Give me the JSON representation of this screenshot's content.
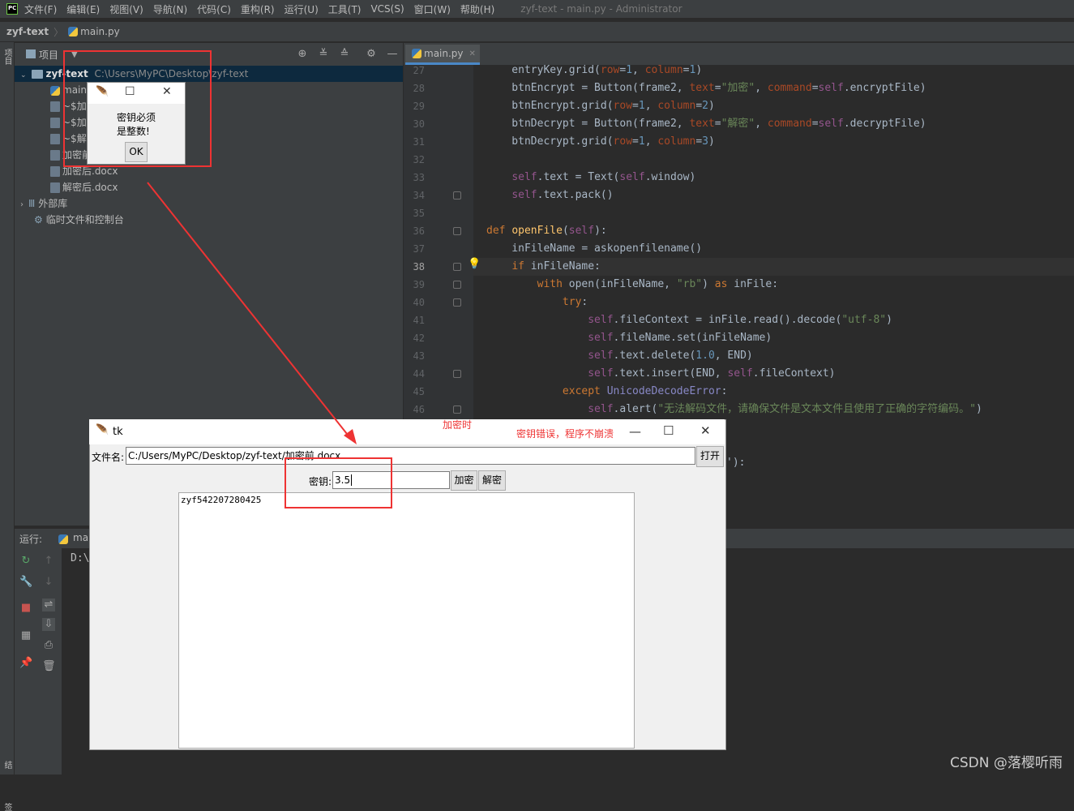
{
  "menu": {
    "logo": "PC",
    "items": [
      "文件(F)",
      "编辑(E)",
      "视图(V)",
      "导航(N)",
      "代码(C)",
      "重构(R)",
      "运行(U)",
      "工具(T)",
      "VCS(S)",
      "窗口(W)",
      "帮助(H)"
    ],
    "window_title": "zyf-text - main.py - Administrator"
  },
  "breadcrumb": {
    "project": "zyf-text",
    "file": "main.py"
  },
  "side_stripe": {
    "top": "项目",
    "bottom": "结构",
    "bottom2": "签"
  },
  "project_panel": {
    "header": "项目",
    "root_name": "zyf-text",
    "root_path": "C:\\Users\\MyPC\\Desktop\\zyf-text",
    "files": [
      "main",
      "~$加",
      "~$加",
      "~$解",
      "加密前",
      "加密后.docx",
      "解密后.docx"
    ],
    "external": "外部库",
    "scratches": "临时文件和控制台"
  },
  "editor": {
    "tab": "main.py",
    "line_numbers": [
      "27",
      "28",
      "29",
      "30",
      "31",
      "32",
      "33",
      "34",
      "35",
      "36",
      "37",
      "38",
      "39",
      "40",
      "41",
      "42",
      "43",
      "44",
      "45",
      "46"
    ]
  },
  "run": {
    "label": "运行:",
    "config": "ma",
    "output": "D:\\"
  },
  "msgbox": {
    "message_line1": "密钥必须",
    "message_line2": "是整数!",
    "ok": "OK"
  },
  "tk_window": {
    "title": "tk",
    "file_label": "文件名:",
    "file_path": "C:/Users/MyPC/Desktop/zyf-text/加密前.docx",
    "open_button": "打开",
    "key_label": "密钥:",
    "key_value": "3.5",
    "encrypt_button": "加密",
    "decrypt_button": "解密",
    "text_content": "zyf542207280425"
  },
  "annotations": {
    "when": "加密时",
    "note": "密钥错误，程序不崩溃"
  },
  "code_tail": "'):",
  "watermark": "CSDN @落樱听雨",
  "colors": {
    "accent": "#4a88c7",
    "annotation": "#e33333",
    "selection": "#0d293e"
  }
}
